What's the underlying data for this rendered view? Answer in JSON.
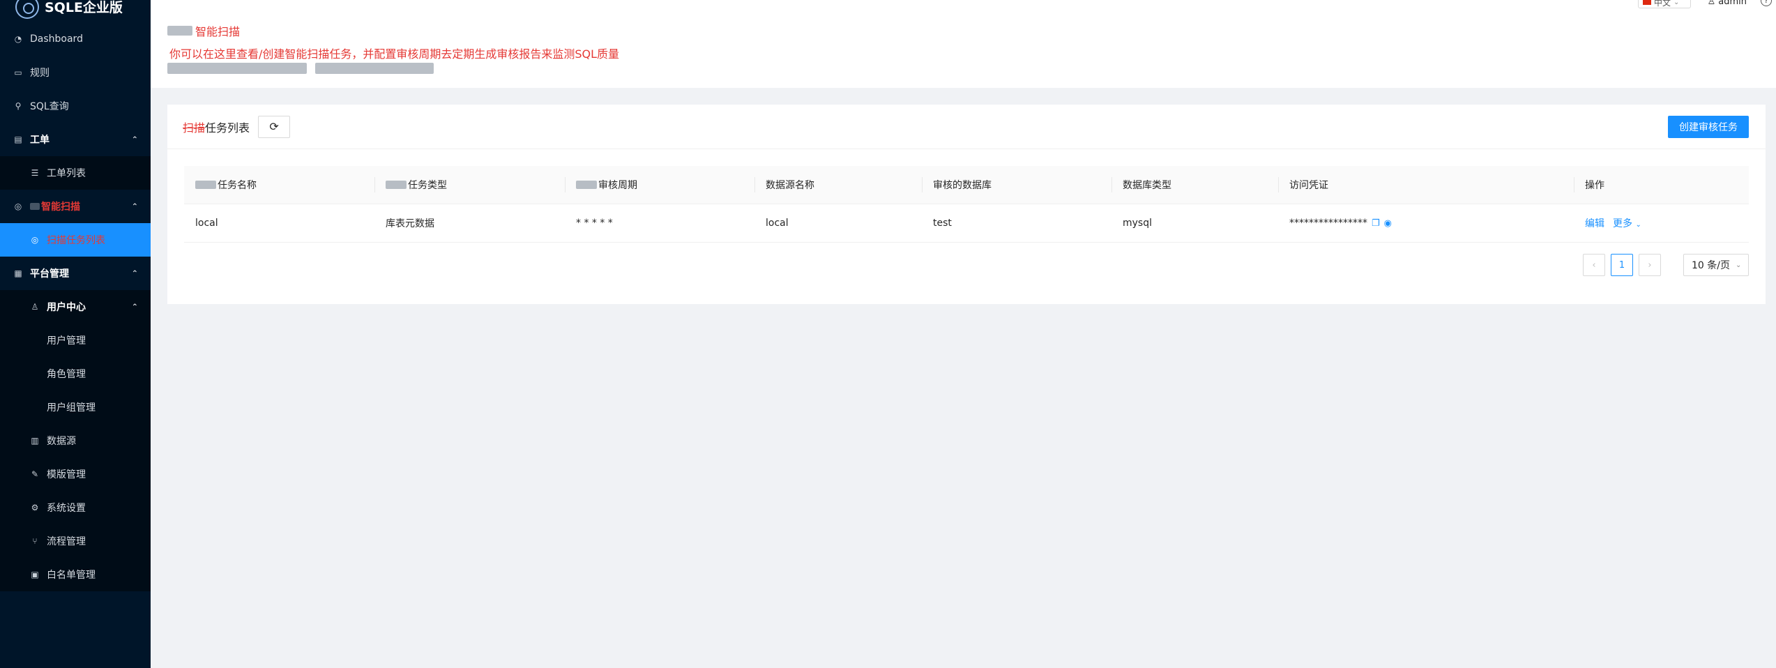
{
  "brand": {
    "name": "SQLE企业版"
  },
  "sidebar": {
    "dashboard": "Dashboard",
    "rules": "规则",
    "sql_query": "SQL查询",
    "workorder": "工单",
    "workorder_list": "工单列表",
    "scan_group": "智能扫描",
    "scan_task_list": "扫描任务列表",
    "platform": "平台管理",
    "user_center": "用户中心",
    "user_manage": "用户管理",
    "role_manage": "角色管理",
    "usergroup_manage": "用户组管理",
    "datasource": "数据源",
    "template": "模版管理",
    "system": "系统设置",
    "workflow": "流程管理",
    "whitelist": "白名单管理"
  },
  "topbar": {
    "language": "中文",
    "user": "admin"
  },
  "header": {
    "title": "智能扫描",
    "description": "你可以在这里查看/创建智能扫描任务，并配置审核周期去定期生成审核报告来监测SQL质量"
  },
  "card": {
    "title_prefix": "扫描",
    "title": "任务列表",
    "create_button": "创建审核任务"
  },
  "table": {
    "headers": [
      "任务名称",
      "任务类型",
      "审核周期",
      "数据源名称",
      "审核的数据库",
      "数据库类型",
      "访问凭证",
      "操作"
    ],
    "rows": [
      {
        "name": "local",
        "type": "库表元数据",
        "cycle": "* * * * *",
        "instance": "local",
        "database": "test",
        "db_type": "mysql",
        "token": "****************",
        "edit": "编辑",
        "more": "更多"
      }
    ]
  },
  "pagination": {
    "current": "1",
    "page_size": "10 条/页"
  }
}
